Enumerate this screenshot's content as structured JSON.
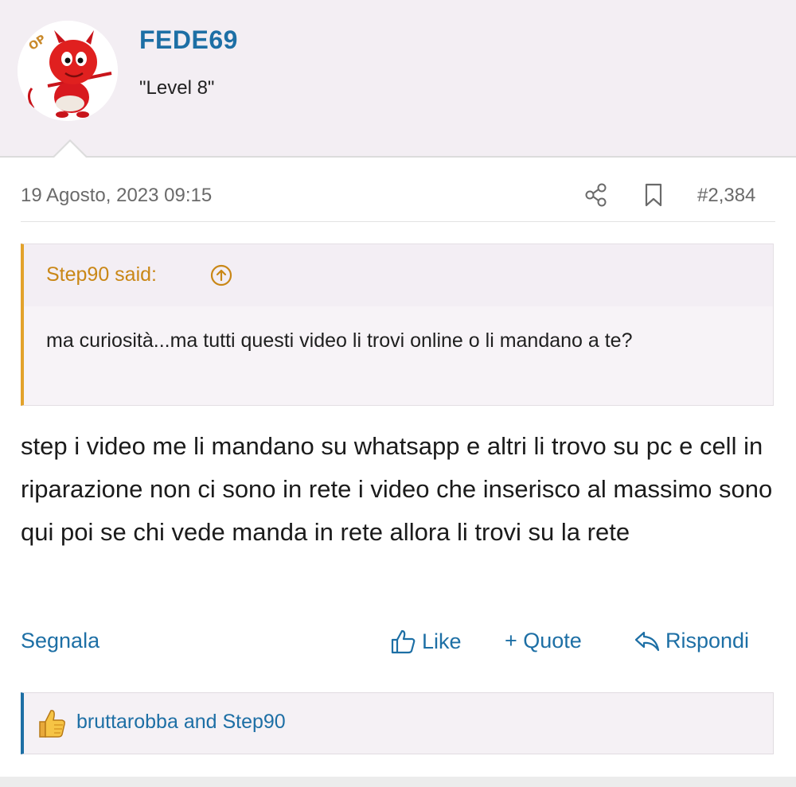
{
  "user": {
    "badge": "OP",
    "name": "FEDE69",
    "title": "\"Level 8\""
  },
  "post": {
    "date": "19 Agosto, 2023 09:15",
    "number": "#2,384",
    "quote": {
      "author": "Step90 said:",
      "text": "ma curiosità...ma tutti questi video li trovi online o li mandano a te?"
    },
    "body": "step i video me li mandano su whatsapp e altri li trovo su pc e cell in riparazione non ci sono in rete i video che inserisco al massimo sono qui poi se chi vede manda in rete allora li trovi su la rete"
  },
  "actions": {
    "report": "Segnala",
    "like": "Like",
    "quote": "+ Quote",
    "reply": "Rispondi"
  },
  "reactions": {
    "text": "bruttarobba and Step90"
  },
  "colors": {
    "link": "#1d6fa5",
    "quote_accent": "#e2a22b",
    "quote_author": "#c98716"
  },
  "icons": [
    "devil-avatar",
    "share-icon",
    "bookmark-icon",
    "arrow-up-circle-icon",
    "thumbs-up-icon",
    "plus-icon",
    "reply-icon",
    "thumb-reaction-icon"
  ]
}
